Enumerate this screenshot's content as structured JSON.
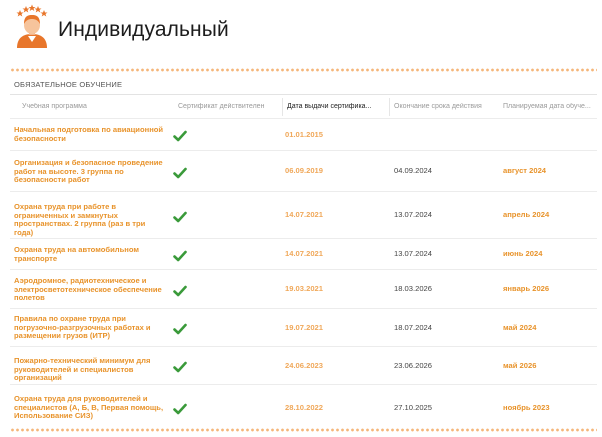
{
  "header": {
    "title": "Индивидуальный",
    "avatar_icon": "user-avatar-icon"
  },
  "section": {
    "title": "ОБЯЗАТЕЛЬНОЕ ОБУЧЕНИЕ"
  },
  "columns": {
    "program": "Учебная программа",
    "certificate": "Сертификат действителен",
    "issue_date": "Дата выдачи сертифика...",
    "expiry": "Окончание срока действия",
    "planned": "Планируемая дата обуче..."
  },
  "colors": {
    "accent": "#e8932b",
    "check": "#3a9a3a",
    "dots": "#f5b67a"
  },
  "rows": [
    {
      "program": "Начальная подготовка по авиационной безопасности",
      "valid": true,
      "issue": "01.01.2015",
      "expiry": "",
      "planned": ""
    },
    {
      "program": "Организация и безопасное проведение работ на высоте. 3 группа по безопасности работ",
      "valid": true,
      "issue": "06.09.2019",
      "expiry": "04.09.2024",
      "planned": "август 2024"
    },
    {
      "program": "Охрана труда при работе в ограниченных и замкнутых пространствах. 2 группа (раз в три года)",
      "valid": true,
      "issue": "14.07.2021",
      "expiry": "13.07.2024",
      "planned": "апрель 2024"
    },
    {
      "program": "Охрана труда на автомобильном транспорте",
      "valid": true,
      "issue": "14.07.2021",
      "expiry": "13.07.2024",
      "planned": "июнь 2024"
    },
    {
      "program": "Аэродромное, радиотехническое и электросветотехническое обеспечение полетов",
      "valid": true,
      "issue": "19.03.2021",
      "expiry": "18.03.2026",
      "planned": "январь 2026"
    },
    {
      "program": "Правила по охране труда при погрузочно-разгрузочных работах и размещении грузов (ИТР)",
      "valid": true,
      "issue": "19.07.2021",
      "expiry": "18.07.2024",
      "planned": "май 2024"
    },
    {
      "program": "Пожарно-технический минимум для руководителей и специалистов организаций",
      "valid": true,
      "issue": "24.06.2023",
      "expiry": "23.06.2026",
      "planned": "май 2026"
    },
    {
      "program": "Охрана труда для руководителей и специалистов (А, Б, В, Первая помощь, Использование СИЗ)",
      "valid": true,
      "issue": "28.10.2022",
      "expiry": "27.10.2025",
      "planned": "ноябрь 2023"
    }
  ]
}
